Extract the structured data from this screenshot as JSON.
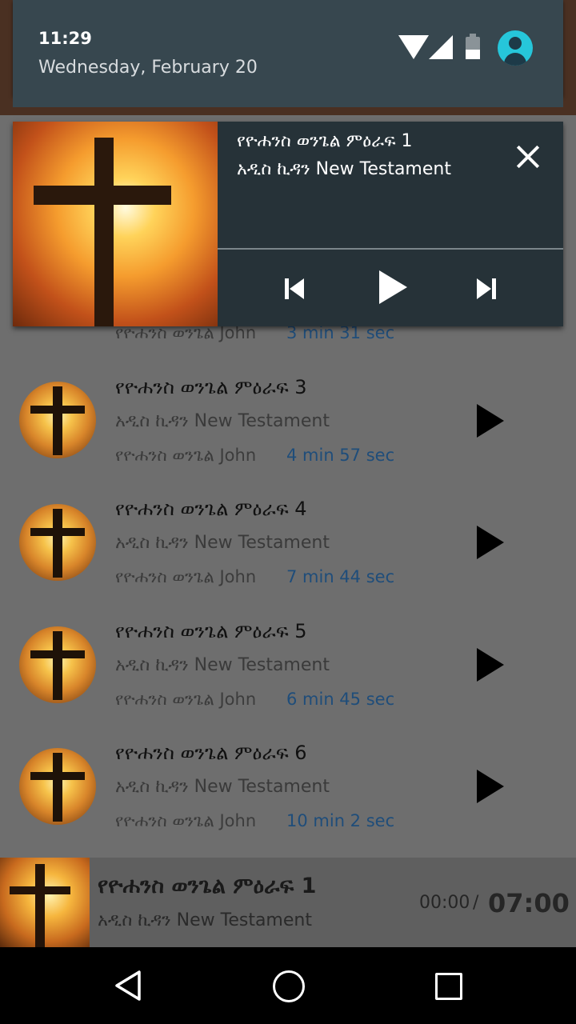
{
  "status": {
    "time": "11:29",
    "date": "Wednesday, February 20"
  },
  "notification": {
    "title": "የዮሐንስ ወንጌል ምዕራፍ 1",
    "subtitle": "አዲስ ኪዳን New Testament"
  },
  "list": {
    "items": [
      {
        "title": "",
        "album": "",
        "artist": "የዮሐንስ ወንጌል John",
        "duration": "3 min 31 sec"
      },
      {
        "title": "የዮሐንስ ወንጌል ምዕራፍ 3",
        "album": "አዲስ ኪዳን New Testament",
        "artist": "የዮሐንስ ወንጌል John",
        "duration": "4 min 57 sec"
      },
      {
        "title": "የዮሐንስ ወንጌል ምዕራፍ 4",
        "album": "አዲስ ኪዳን New Testament",
        "artist": "የዮሐንስ ወንጌል John",
        "duration": "7 min 44 sec"
      },
      {
        "title": "የዮሐንስ ወንጌል ምዕራፍ 5",
        "album": "አዲስ ኪዳን New Testament",
        "artist": "የዮሐንስ ወንጌል John",
        "duration": "6 min 45 sec"
      },
      {
        "title": "የዮሐንስ ወንጌል ምዕራፍ 6",
        "album": "አዲስ ኪዳን New Testament",
        "artist": "የዮሐንስ ወንጌል John",
        "duration": "10 min 2 sec"
      }
    ]
  },
  "player": {
    "title": "የዮሐንስ ወንጌል ምዕራፍ 1",
    "subtitle": "አዲስ ኪዳን New Testament",
    "current": "00:00",
    "separator": "/",
    "total": "07:00"
  }
}
